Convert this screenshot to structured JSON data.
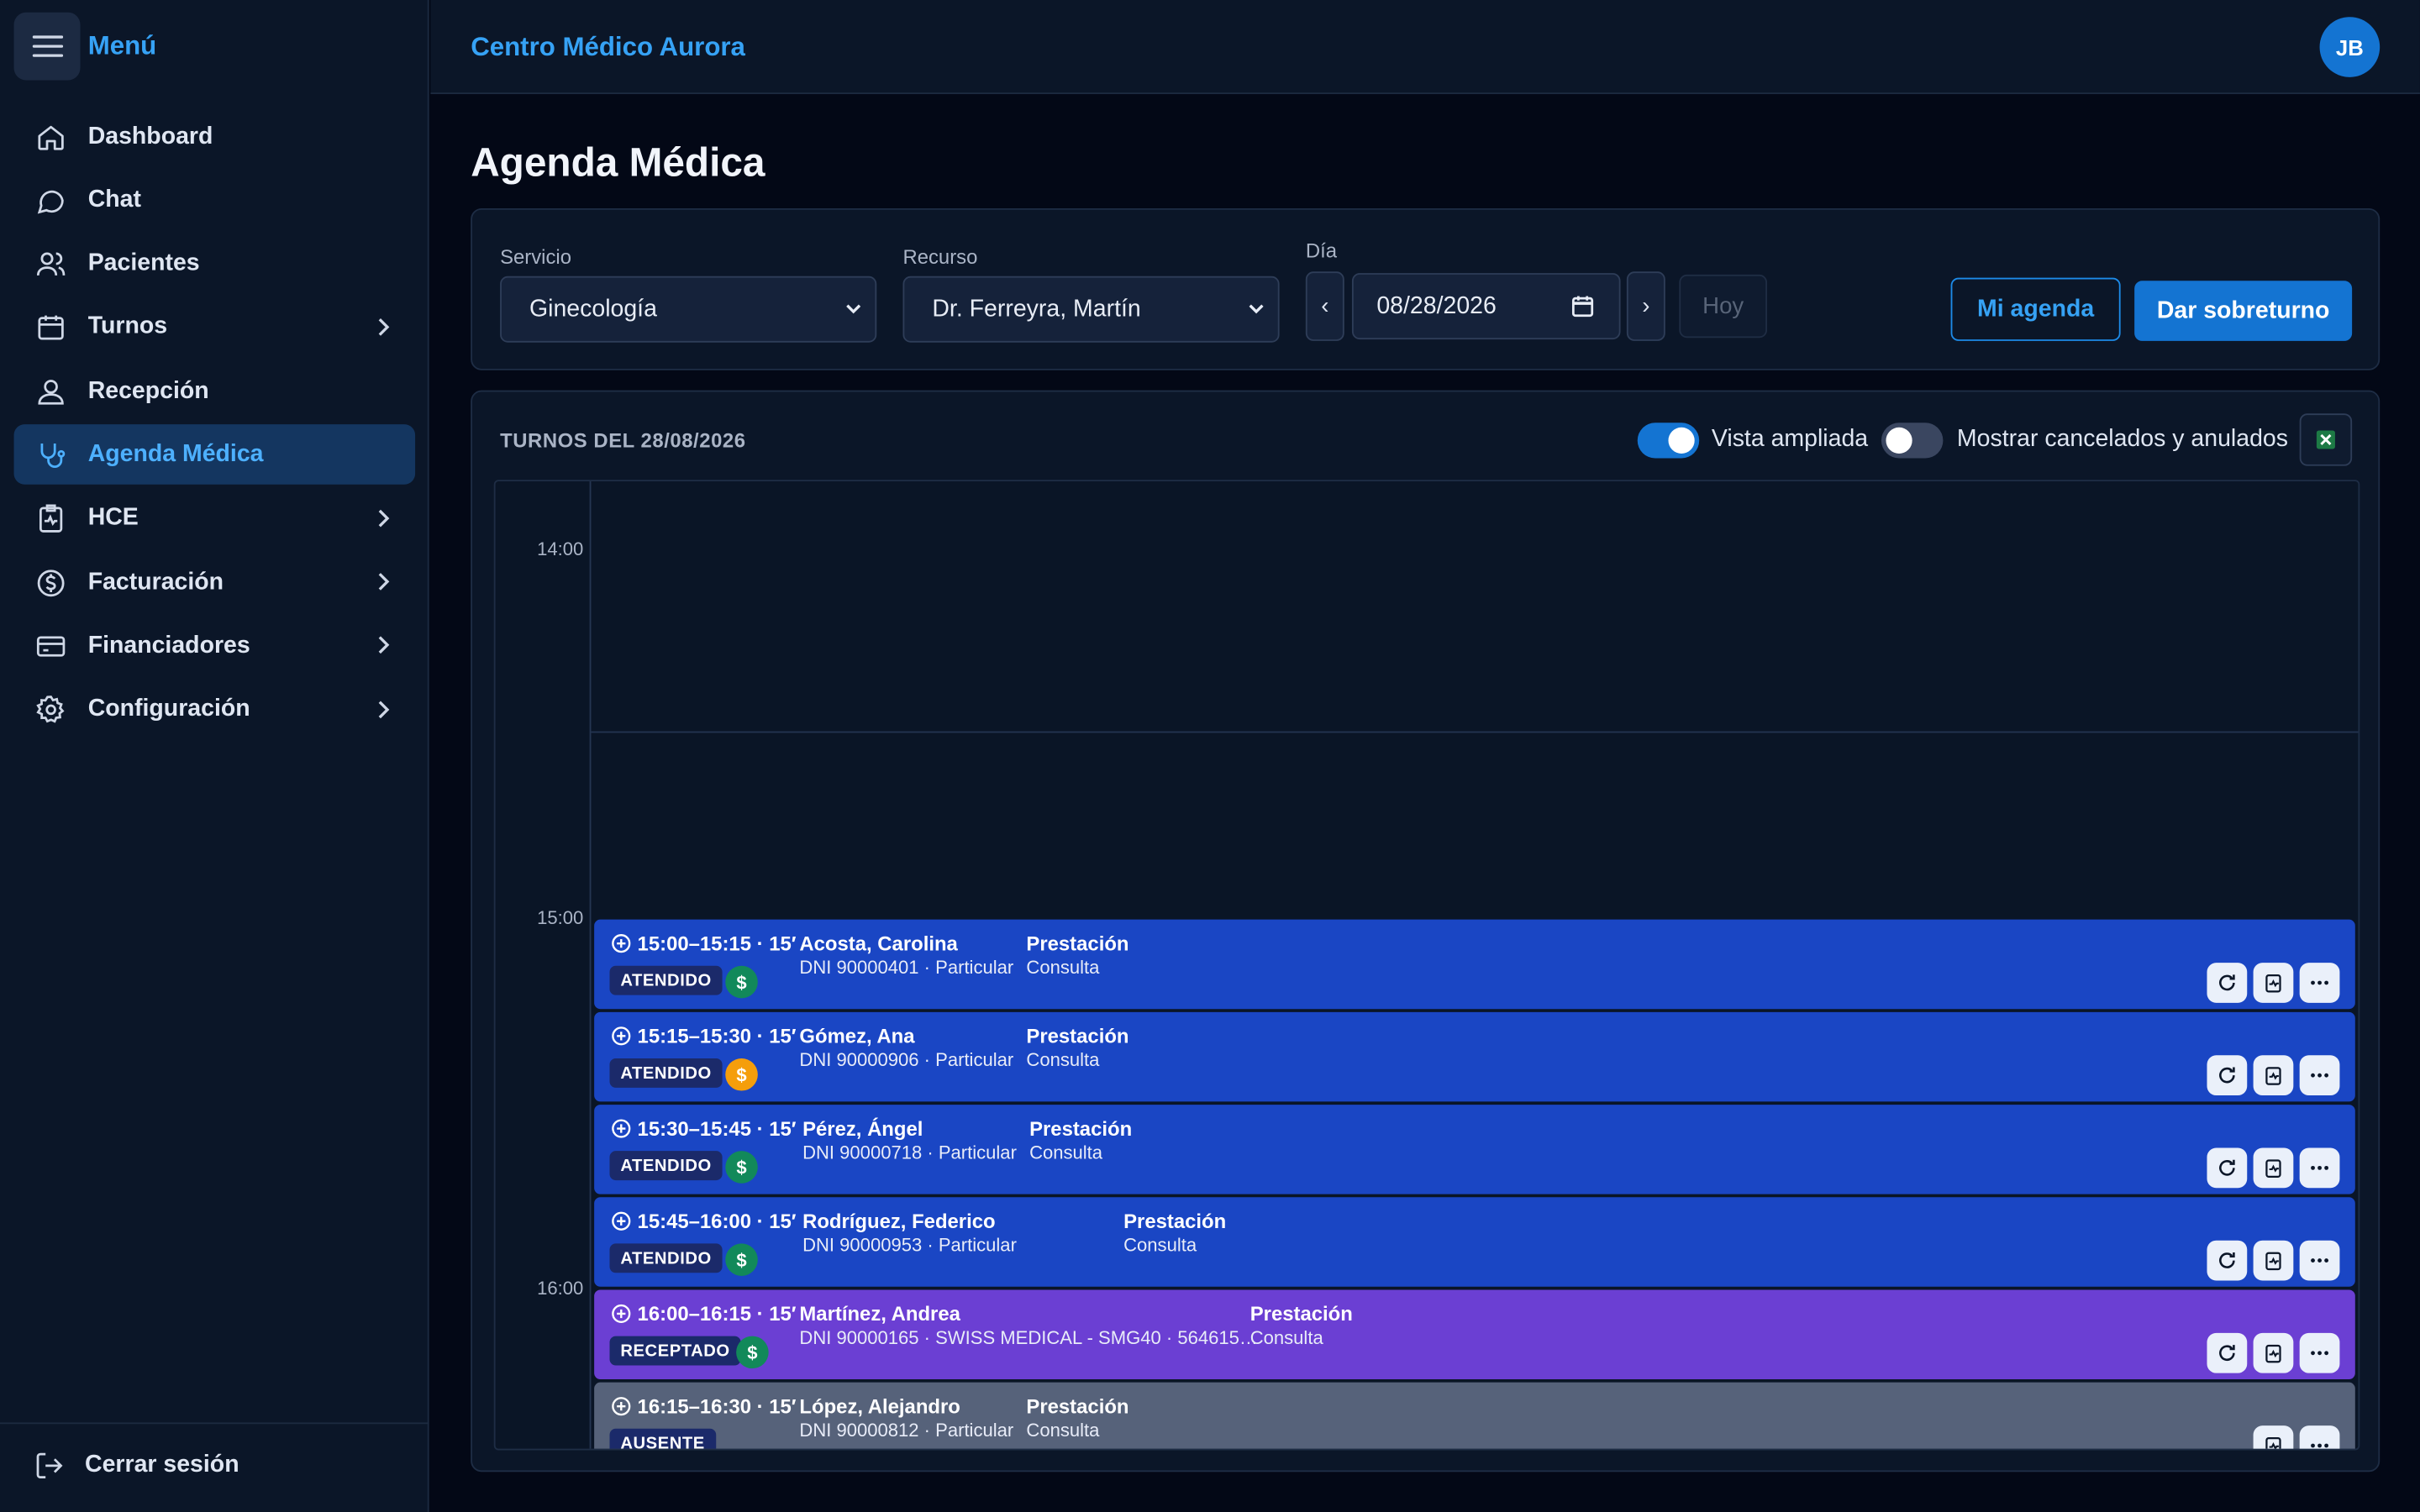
{
  "sidebar": {
    "menu_title": "Menú",
    "items": [
      {
        "label": "Dashboard",
        "icon": "home-icon"
      },
      {
        "label": "Chat",
        "icon": "chat-icon"
      },
      {
        "label": "Pacientes",
        "icon": "users-icon"
      },
      {
        "label": "Turnos",
        "icon": "calendar-icon",
        "has_submenu": true
      },
      {
        "label": "Recepción",
        "icon": "user-icon"
      },
      {
        "label": "Agenda Médica",
        "icon": "stethoscope-icon",
        "active": true
      },
      {
        "label": "HCE",
        "icon": "clipboard-pulse-icon",
        "has_submenu": true
      },
      {
        "label": "Facturación",
        "icon": "dollar-circle-icon",
        "has_submenu": true
      },
      {
        "label": "Financiadores",
        "icon": "credit-card-icon",
        "has_submenu": true
      },
      {
        "label": "Configuración",
        "icon": "gear-icon",
        "has_submenu": true
      }
    ],
    "logout_label": "Cerrar sesión"
  },
  "header": {
    "brand": "Centro Médico Aurora",
    "avatar_initials": "JB"
  },
  "page": {
    "title": "Agenda Médica"
  },
  "filters": {
    "servicio_label": "Servicio",
    "servicio_value": "Ginecología",
    "recurso_label": "Recurso",
    "recurso_value": "Dr. Ferreyra, Martín",
    "dia_label": "Día",
    "dia_value": "08/28/2026",
    "prev_symbol": "‹",
    "next_symbol": "›",
    "hoy_label": "Hoy",
    "mi_agenda_label": "Mi agenda",
    "sobreturno_label": "Dar sobreturno"
  },
  "schedule": {
    "title": "TURNOS DEL 28/08/2026",
    "vista_ampliada_label": "Vista ampliada",
    "vista_ampliada_on": true,
    "mostrar_cancelados_label": "Mostrar cancelados y anulados",
    "mostrar_cancelados_on": false,
    "hours": [
      "14:00",
      "15:00",
      "16:00"
    ],
    "appointments": [
      {
        "time": "15:00–15:15 · 15′",
        "status": "ATENDIDO",
        "payment": "paid",
        "patient": "Acosta, Carolina",
        "info": "DNI 90000401 · Particular",
        "service_title": "Prestación",
        "service": "Consulta",
        "color": "#1a46c4"
      },
      {
        "time": "15:15–15:30 · 15′",
        "status": "ATENDIDO",
        "payment": "pending",
        "patient": "Gómez, Ana",
        "info": "DNI 90000906 · Particular",
        "service_title": "Prestación",
        "service": "Consulta",
        "color": "#1a46c4"
      },
      {
        "time": "15:30–15:45 · 15′",
        "status": "ATENDIDO",
        "payment": "paid",
        "patient": "Pérez, Ángel",
        "info": "DNI 90000718 · Particular",
        "service_title": "Prestación",
        "service": "Consulta",
        "color": "#1a46c4"
      },
      {
        "time": "15:45–16:00 · 15′",
        "status": "ATENDIDO",
        "payment": "paid",
        "patient": "Rodríguez, Federico",
        "info": "DNI 90000953 · Particular",
        "service_title": "Prestación",
        "service": "Consulta",
        "color": "#1a46c4"
      },
      {
        "time": "16:00–16:15 · 15′",
        "status": "RECEPTADO",
        "payment": "paid",
        "patient": "Martínez, Andrea",
        "info": "DNI 90000165 · SWISS MEDICAL - SMG40 · 564615…",
        "service_title": "Prestación",
        "service": "Consulta",
        "color": "#6b3fd3"
      },
      {
        "time": "16:15–16:30 · 15′",
        "status": "AUSENTE",
        "payment": "none",
        "patient": "López, Alejandro",
        "info": "DNI 90000812 · Particular",
        "service_title": "Prestación",
        "service": "Consulta",
        "color": "#56627a"
      }
    ],
    "colors": {
      "paid": "#12895a",
      "pending": "#f59e0b",
      "toggle_on": "#1474d2",
      "toggle_off": "#3a4660"
    }
  }
}
